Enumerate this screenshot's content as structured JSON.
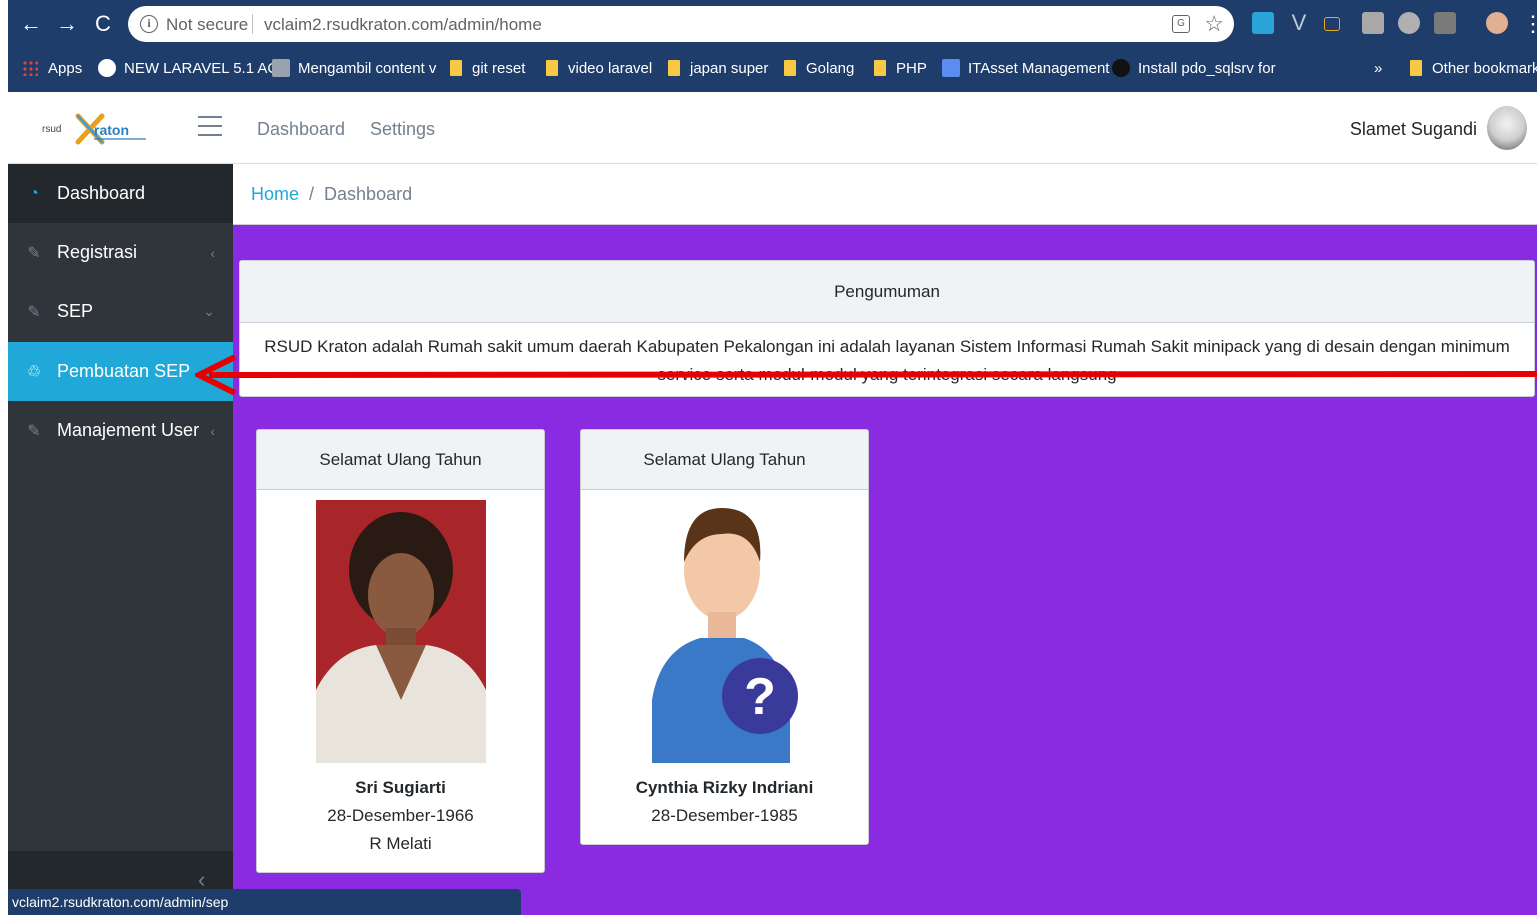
{
  "browser": {
    "security_label": "Not secure",
    "url": "vclaim2.rsudkraton.com/admin/home",
    "bookmarks": [
      "Apps",
      "NEW LARAVEL 5.1 AC",
      "Mengambil content v",
      "git reset",
      "video laravel",
      "japan super",
      "Golang",
      "PHP",
      "ITAsset Management",
      "Install pdo_sqlsrv for"
    ],
    "more_label": "»",
    "other_bookmarks": "Other bookmarks"
  },
  "navbar": {
    "logo_text_left": "rsud",
    "logo_text_right": "raton",
    "links": [
      "Dashboard",
      "Settings"
    ],
    "user_name": "Slamet Sugandi"
  },
  "sidebar": {
    "items": [
      {
        "label": "Dashboard",
        "icon": "speedometer-icon"
      },
      {
        "label": "Registrasi",
        "icon": "pencil-icon",
        "caret": "‹"
      },
      {
        "label": "SEP",
        "icon": "pencil-icon",
        "caret": "⌄"
      },
      {
        "label": "Pembuatan SEP",
        "icon": "puzzle-icon"
      },
      {
        "label": "Manajement User",
        "icon": "pencil-icon",
        "caret": "‹"
      }
    ],
    "minimize": "‹"
  },
  "breadcrumb": {
    "home": "Home",
    "separator": "/",
    "current": "Dashboard"
  },
  "announcement": {
    "title": "Pengumuman",
    "body": "RSUD Kraton adalah Rumah sakit umum daerah Kabupaten Pekalongan ini adalah layanan Sistem Informasi Rumah Sakit minipack yang di desain dengan minimum service serta modul-modul yang terintegrasi secara langsung"
  },
  "birthdays": [
    {
      "title": "Selamat Ulang Tahun",
      "name": "Sri Sugiarti",
      "date": "28-Desember-1966",
      "unit": "R Melati"
    },
    {
      "title": "Selamat Ulang Tahun",
      "name": "Cynthia Rizky Indriani",
      "date": "28-Desember-1985"
    }
  ],
  "status_bar": {
    "url": "vclaim2.rsudkraton.com/admin/sep"
  },
  "colors": {
    "main_bg": "#8a2be2",
    "sidebar_bg": "#2f353a",
    "active_item": "#20a8d8",
    "chrome_bg": "#1f3d6b",
    "annotation_arrow": "#e60000"
  }
}
